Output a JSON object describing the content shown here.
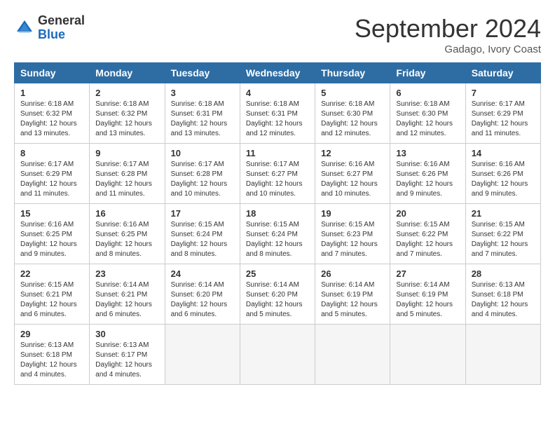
{
  "header": {
    "logo_general": "General",
    "logo_blue": "Blue",
    "month_title": "September 2024",
    "location": "Gadago, Ivory Coast"
  },
  "calendar": {
    "weekdays": [
      "Sunday",
      "Monday",
      "Tuesday",
      "Wednesday",
      "Thursday",
      "Friday",
      "Saturday"
    ],
    "weeks": [
      [
        {
          "day": "1",
          "info": "Sunrise: 6:18 AM\nSunset: 6:32 PM\nDaylight: 12 hours\nand 13 minutes."
        },
        {
          "day": "2",
          "info": "Sunrise: 6:18 AM\nSunset: 6:32 PM\nDaylight: 12 hours\nand 13 minutes."
        },
        {
          "day": "3",
          "info": "Sunrise: 6:18 AM\nSunset: 6:31 PM\nDaylight: 12 hours\nand 13 minutes."
        },
        {
          "day": "4",
          "info": "Sunrise: 6:18 AM\nSunset: 6:31 PM\nDaylight: 12 hours\nand 12 minutes."
        },
        {
          "day": "5",
          "info": "Sunrise: 6:18 AM\nSunset: 6:30 PM\nDaylight: 12 hours\nand 12 minutes."
        },
        {
          "day": "6",
          "info": "Sunrise: 6:18 AM\nSunset: 6:30 PM\nDaylight: 12 hours\nand 12 minutes."
        },
        {
          "day": "7",
          "info": "Sunrise: 6:17 AM\nSunset: 6:29 PM\nDaylight: 12 hours\nand 11 minutes."
        }
      ],
      [
        {
          "day": "8",
          "info": "Sunrise: 6:17 AM\nSunset: 6:29 PM\nDaylight: 12 hours\nand 11 minutes."
        },
        {
          "day": "9",
          "info": "Sunrise: 6:17 AM\nSunset: 6:28 PM\nDaylight: 12 hours\nand 11 minutes."
        },
        {
          "day": "10",
          "info": "Sunrise: 6:17 AM\nSunset: 6:28 PM\nDaylight: 12 hours\nand 10 minutes."
        },
        {
          "day": "11",
          "info": "Sunrise: 6:17 AM\nSunset: 6:27 PM\nDaylight: 12 hours\nand 10 minutes."
        },
        {
          "day": "12",
          "info": "Sunrise: 6:16 AM\nSunset: 6:27 PM\nDaylight: 12 hours\nand 10 minutes."
        },
        {
          "day": "13",
          "info": "Sunrise: 6:16 AM\nSunset: 6:26 PM\nDaylight: 12 hours\nand 9 minutes."
        },
        {
          "day": "14",
          "info": "Sunrise: 6:16 AM\nSunset: 6:26 PM\nDaylight: 12 hours\nand 9 minutes."
        }
      ],
      [
        {
          "day": "15",
          "info": "Sunrise: 6:16 AM\nSunset: 6:25 PM\nDaylight: 12 hours\nand 9 minutes."
        },
        {
          "day": "16",
          "info": "Sunrise: 6:16 AM\nSunset: 6:25 PM\nDaylight: 12 hours\nand 8 minutes."
        },
        {
          "day": "17",
          "info": "Sunrise: 6:15 AM\nSunset: 6:24 PM\nDaylight: 12 hours\nand 8 minutes."
        },
        {
          "day": "18",
          "info": "Sunrise: 6:15 AM\nSunset: 6:24 PM\nDaylight: 12 hours\nand 8 minutes."
        },
        {
          "day": "19",
          "info": "Sunrise: 6:15 AM\nSunset: 6:23 PM\nDaylight: 12 hours\nand 7 minutes."
        },
        {
          "day": "20",
          "info": "Sunrise: 6:15 AM\nSunset: 6:22 PM\nDaylight: 12 hours\nand 7 minutes."
        },
        {
          "day": "21",
          "info": "Sunrise: 6:15 AM\nSunset: 6:22 PM\nDaylight: 12 hours\nand 7 minutes."
        }
      ],
      [
        {
          "day": "22",
          "info": "Sunrise: 6:15 AM\nSunset: 6:21 PM\nDaylight: 12 hours\nand 6 minutes."
        },
        {
          "day": "23",
          "info": "Sunrise: 6:14 AM\nSunset: 6:21 PM\nDaylight: 12 hours\nand 6 minutes."
        },
        {
          "day": "24",
          "info": "Sunrise: 6:14 AM\nSunset: 6:20 PM\nDaylight: 12 hours\nand 6 minutes."
        },
        {
          "day": "25",
          "info": "Sunrise: 6:14 AM\nSunset: 6:20 PM\nDaylight: 12 hours\nand 5 minutes."
        },
        {
          "day": "26",
          "info": "Sunrise: 6:14 AM\nSunset: 6:19 PM\nDaylight: 12 hours\nand 5 minutes."
        },
        {
          "day": "27",
          "info": "Sunrise: 6:14 AM\nSunset: 6:19 PM\nDaylight: 12 hours\nand 5 minutes."
        },
        {
          "day": "28",
          "info": "Sunrise: 6:13 AM\nSunset: 6:18 PM\nDaylight: 12 hours\nand 4 minutes."
        }
      ],
      [
        {
          "day": "29",
          "info": "Sunrise: 6:13 AM\nSunset: 6:18 PM\nDaylight: 12 hours\nand 4 minutes."
        },
        {
          "day": "30",
          "info": "Sunrise: 6:13 AM\nSunset: 6:17 PM\nDaylight: 12 hours\nand 4 minutes."
        },
        {
          "day": "",
          "info": ""
        },
        {
          "day": "",
          "info": ""
        },
        {
          "day": "",
          "info": ""
        },
        {
          "day": "",
          "info": ""
        },
        {
          "day": "",
          "info": ""
        }
      ]
    ]
  }
}
